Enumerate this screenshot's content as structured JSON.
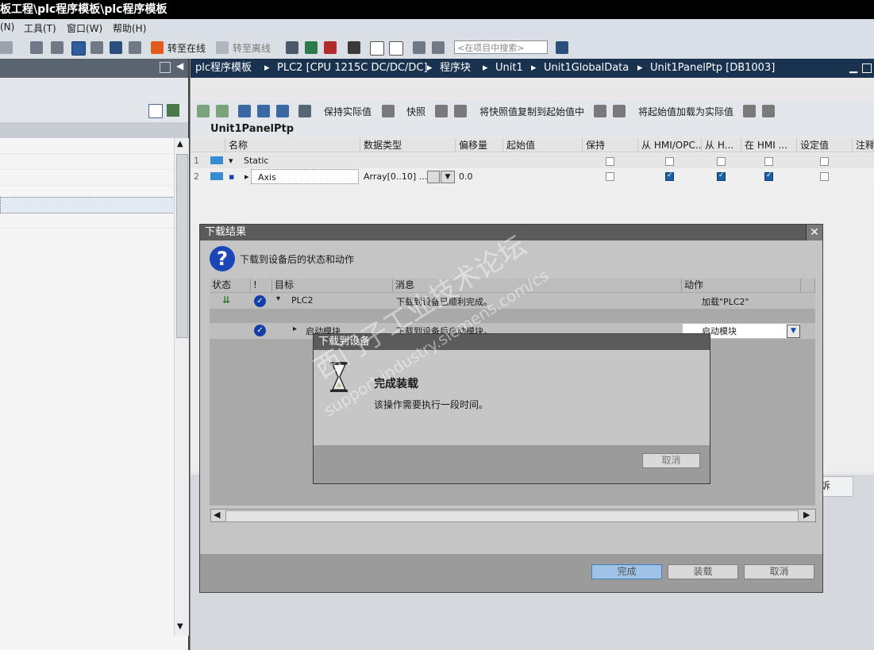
{
  "window": {
    "title": "板工程\\plc程序模板\\plc程序模板"
  },
  "menu": {
    "items": [
      "(N)",
      "工具(T)",
      "窗口(W)",
      "帮助(H)"
    ]
  },
  "toolbar": {
    "go_online": "转至在线",
    "go_offline": "转至离线",
    "search_placeholder": "<在项目中搜索>"
  },
  "breadcrumb": [
    "plc程序模板",
    "PLC2 [CPU 1215C DC/DC/DC]",
    "程序块",
    "Unit1",
    "Unit1GlobalData",
    "Unit1PanelPtp [DB1003]"
  ],
  "editor_toolbar": {
    "keep_actual": "保持实际值",
    "snapshot": "快照",
    "copy_snapshot": "将快照值复制到起始值中",
    "load_start": "将起始值加载为实际值"
  },
  "block": {
    "name": "Unit1PanelPtp",
    "columns": [
      "名称",
      "数据类型",
      "偏移量",
      "起始值",
      "保持",
      "从 HMI/OPC...",
      "从 H...",
      "在 HMI ...",
      "设定值",
      "注释"
    ],
    "rows": [
      {
        "num": "1",
        "name": "Static",
        "type": "",
        "offset": "",
        "start": "",
        "keep": false,
        "hmi1": false,
        "hmi2": false,
        "hmi3": false,
        "set": false
      },
      {
        "num": "2",
        "name": "Axis",
        "type": "Array[0..10] ...",
        "offset": "0.0",
        "start": "",
        "keep": false,
        "hmi1": true,
        "hmi2": true,
        "hmi3": true,
        "set": false
      }
    ]
  },
  "bottom_tab": "诉",
  "download_result": {
    "title": "下载结果",
    "heading": "下载到设备后的状态和动作",
    "columns": [
      "状态",
      "!",
      "目标",
      "消息",
      "动作"
    ],
    "rows": [
      {
        "target": "PLC2",
        "message": "下载到设备已顺利完成。",
        "action": "加载\"PLC2\""
      },
      {
        "target": "启动模块",
        "message": "下载到设备后启动模块。",
        "action": "启动模块"
      }
    ],
    "buttons": {
      "finish": "完成",
      "load": "装载",
      "cancel": "取消"
    }
  },
  "download_device": {
    "title": "下载到设备",
    "heading": "完成装载",
    "message": "该操作需要执行一段时间。",
    "cancel": "取消"
  },
  "watermark": [
    "西门子工业技术论坛",
    "support.industry.siemens.com/cs"
  ]
}
